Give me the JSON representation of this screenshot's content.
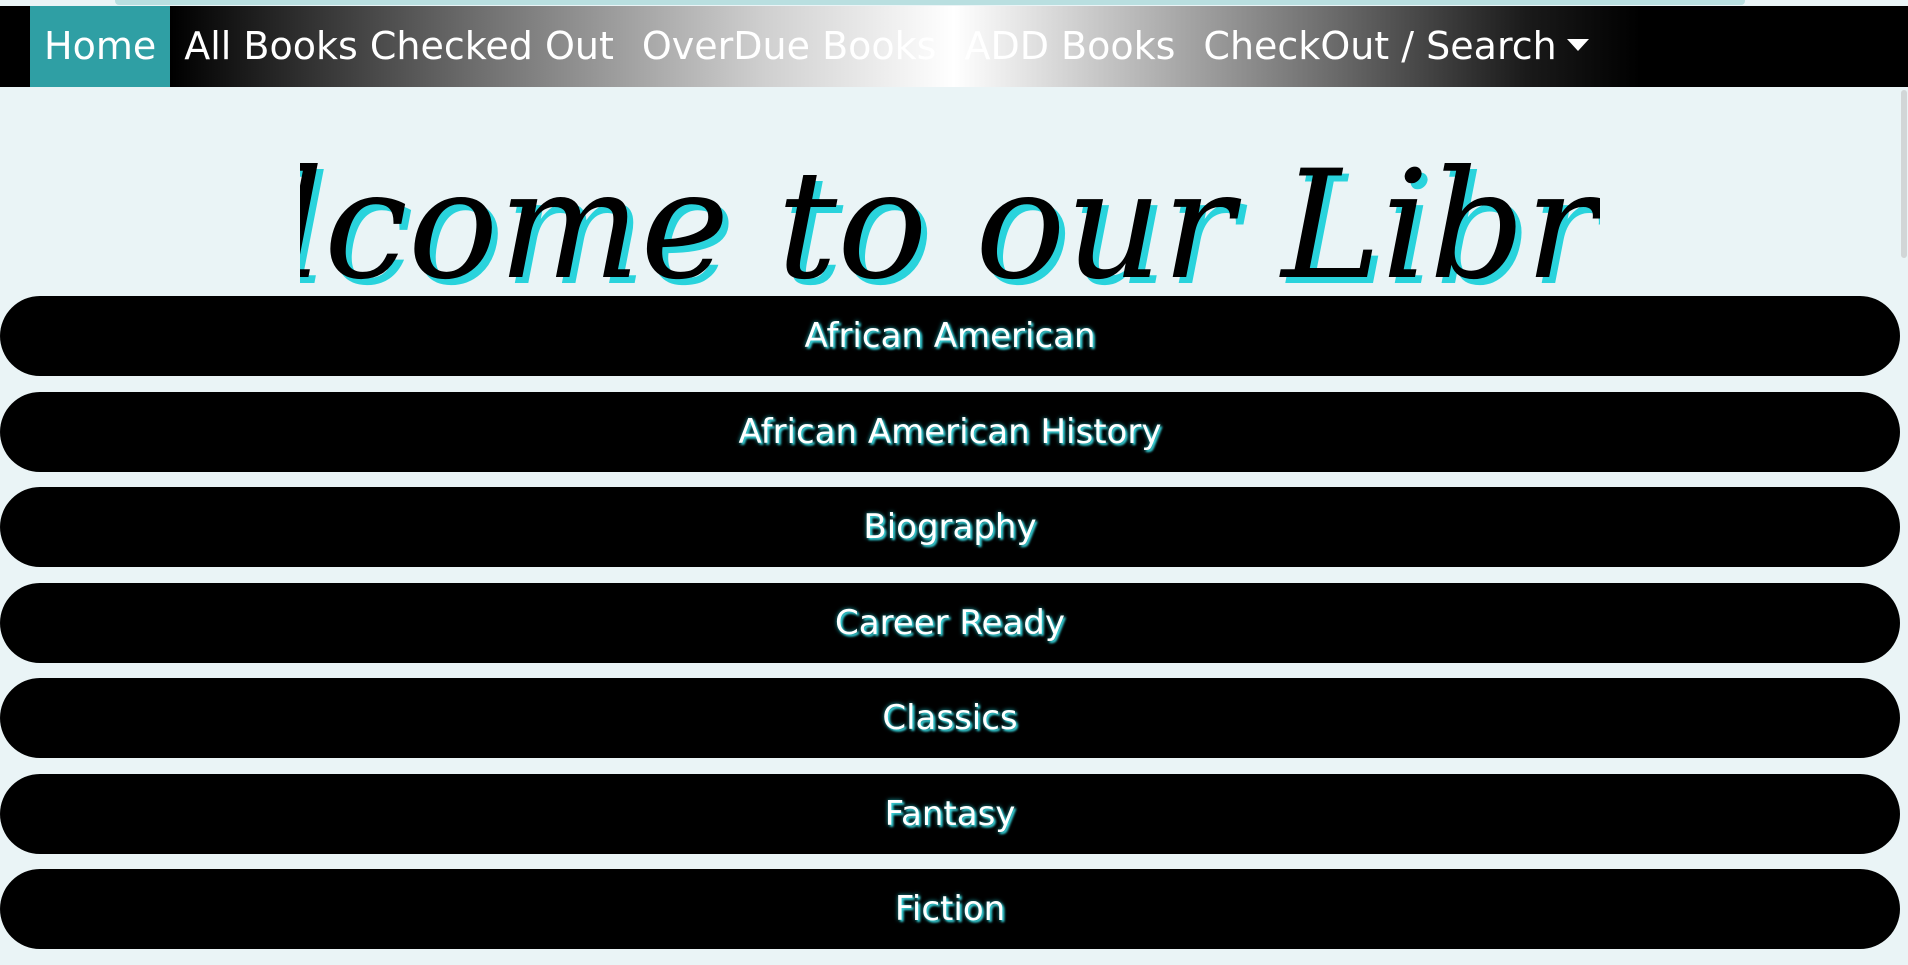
{
  "navbar": {
    "items": [
      {
        "label": "Home",
        "active": true
      },
      {
        "label": "All Books Checked Out",
        "active": false
      },
      {
        "label": "OverDue Books",
        "active": false
      },
      {
        "label": "ADD Books",
        "active": false
      },
      {
        "label": "CheckOut / Search",
        "active": false,
        "dropdown": true
      }
    ],
    "caret_icon": "caret-down-icon"
  },
  "page": {
    "title": "Welcome to our Library"
  },
  "genres": [
    "African American",
    "African American History",
    "Biography",
    "Career Ready",
    "Classics",
    "Fantasy",
    "Fiction"
  ],
  "colors": {
    "accent": "#2f9fa4",
    "title_shadow": "#29d3dc",
    "background": "#eaf4f6",
    "button_bg": "#000000"
  }
}
